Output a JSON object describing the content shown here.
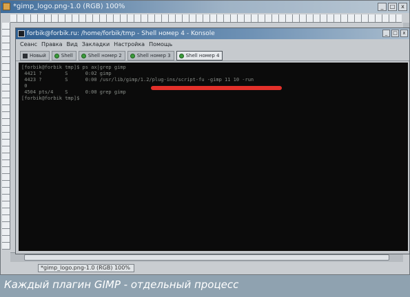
{
  "gimp_window": {
    "title": "*gimp_logo.png-1.0 (RGB) 100%",
    "controls": [
      "_",
      "□",
      "x"
    ],
    "status_text": "*gimp_logo.png-1.0 (RGB) 100%"
  },
  "konsole": {
    "title": "forbik@forbik.ru: /home/forbik/tmp - Shell номер 4 - Konsole",
    "controls": [
      "_",
      "□",
      "x"
    ],
    "menu": [
      "Сеанс",
      "Правка",
      "Вид",
      "Закладки",
      "Настройка",
      "Помощь"
    ],
    "tabs": [
      {
        "label": "Новый",
        "icon": "new-session-icon"
      },
      {
        "label": "Shell",
        "icon": "shell-icon"
      },
      {
        "label": "Shell номер 2",
        "icon": "shell-icon"
      },
      {
        "label": "Shell номер 3",
        "icon": "shell-icon"
      },
      {
        "label": "Shell номер 4",
        "icon": "shell-icon"
      }
    ],
    "active_tab": 4,
    "terminal_lines": [
      "[forbik@forbik tmp]$ ps ax|grep gimp",
      " 4421 ?        S      0:02 gimp",
      " 4423 ?        S      0:00 /usr/lib/gimp/1.2/plug-ins/script-fu -gimp 11 10 -run",
      " 0",
      " 4504 pts/4    S      0:00 grep gimp",
      "[forbik@forbik tmp]$ "
    ],
    "highlight_color": "#e3302a"
  },
  "caption": {
    "text": "Каждый плагин GIMP - отдельный процесс"
  }
}
